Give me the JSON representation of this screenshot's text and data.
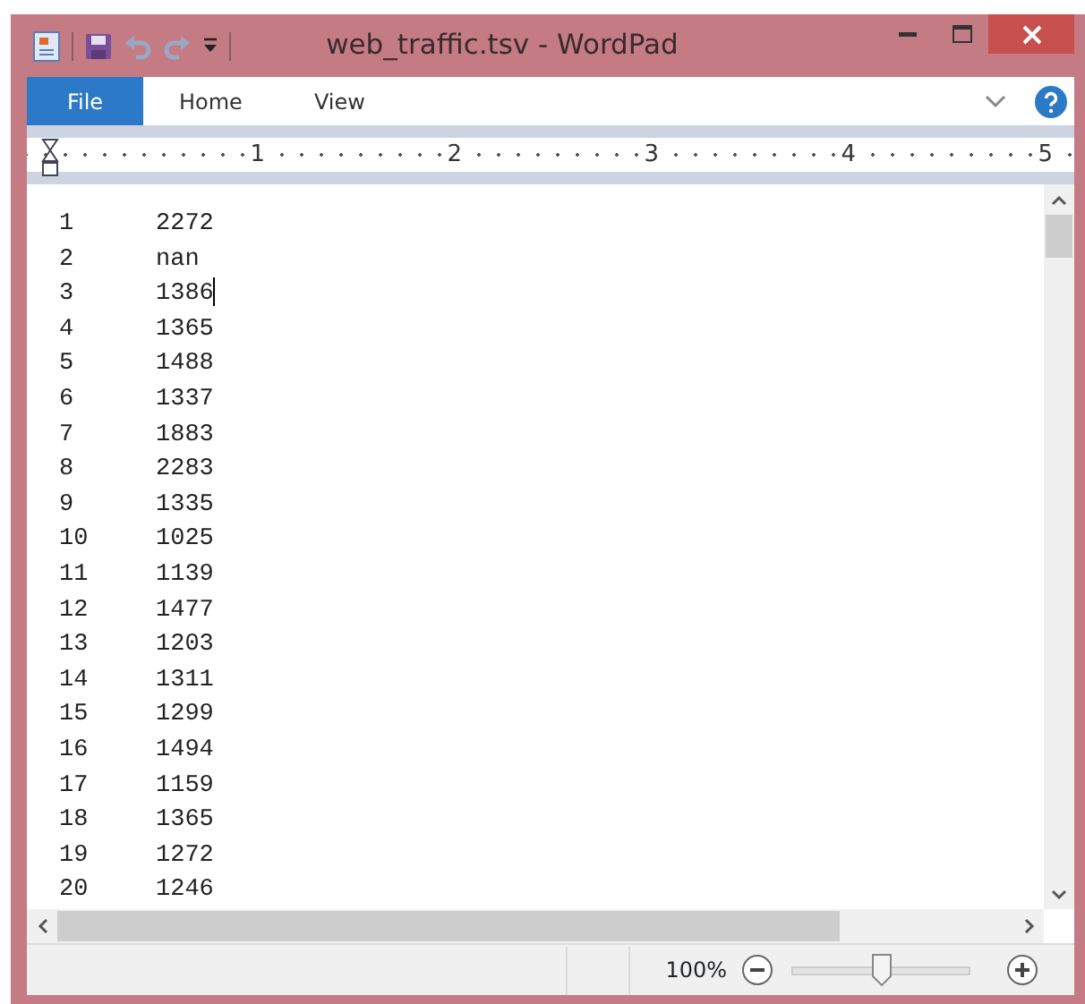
{
  "window": {
    "title": "web_traffic.tsv - WordPad"
  },
  "tabs": [
    {
      "label": "File",
      "kind": "file",
      "selected": false
    },
    {
      "label": "Home",
      "kind": "tab",
      "selected": false
    },
    {
      "label": "View",
      "kind": "tab",
      "selected": false
    }
  ],
  "ruler": {
    "labels": [
      "1",
      "2",
      "3",
      "4",
      "5"
    ]
  },
  "document": {
    "rows": [
      {
        "column_1": "1",
        "column_2": "2272",
        "caret": false
      },
      {
        "column_1": "2",
        "column_2": "nan",
        "caret": false
      },
      {
        "column_1": "3",
        "column_2": "1386",
        "caret": true
      },
      {
        "column_1": "4",
        "column_2": "1365",
        "caret": false
      },
      {
        "column_1": "5",
        "column_2": "1488",
        "caret": false
      },
      {
        "column_1": "6",
        "column_2": "1337",
        "caret": false
      },
      {
        "column_1": "7",
        "column_2": "1883",
        "caret": false
      },
      {
        "column_1": "8",
        "column_2": "2283",
        "caret": false
      },
      {
        "column_1": "9",
        "column_2": "1335",
        "caret": false
      },
      {
        "column_1": "10",
        "column_2": "1025",
        "caret": false
      },
      {
        "column_1": "11",
        "column_2": "1139",
        "caret": false
      },
      {
        "column_1": "12",
        "column_2": "1477",
        "caret": false
      },
      {
        "column_1": "13",
        "column_2": "1203",
        "caret": false
      },
      {
        "column_1": "14",
        "column_2": "1311",
        "caret": false
      },
      {
        "column_1": "15",
        "column_2": "1299",
        "caret": false
      },
      {
        "column_1": "16",
        "column_2": "1494",
        "caret": false
      },
      {
        "column_1": "17",
        "column_2": "1159",
        "caret": false
      },
      {
        "column_1": "18",
        "column_2": "1365",
        "caret": false
      },
      {
        "column_1": "19",
        "column_2": "1272",
        "caret": false
      },
      {
        "column_1": "20",
        "column_2": "1246",
        "caret": false
      }
    ]
  },
  "status_bar": {
    "zoom": "100%",
    "zoom_slider": {
      "level": 0.5
    }
  }
}
